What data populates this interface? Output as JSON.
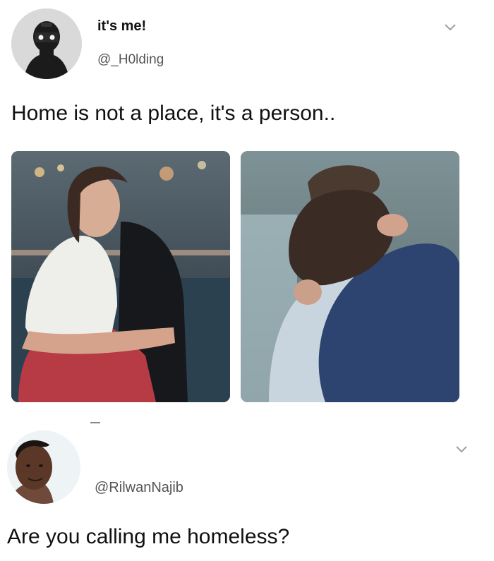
{
  "tweet1": {
    "display_name": "it's me!",
    "handle": "@_H0lding",
    "text": "Home is not a place, it's a person.."
  },
  "tweet2": {
    "handle": "@RilwanNajib",
    "text": "Are you calling me homeless?"
  },
  "icons": {
    "more_options": "chevron-down-icon"
  }
}
